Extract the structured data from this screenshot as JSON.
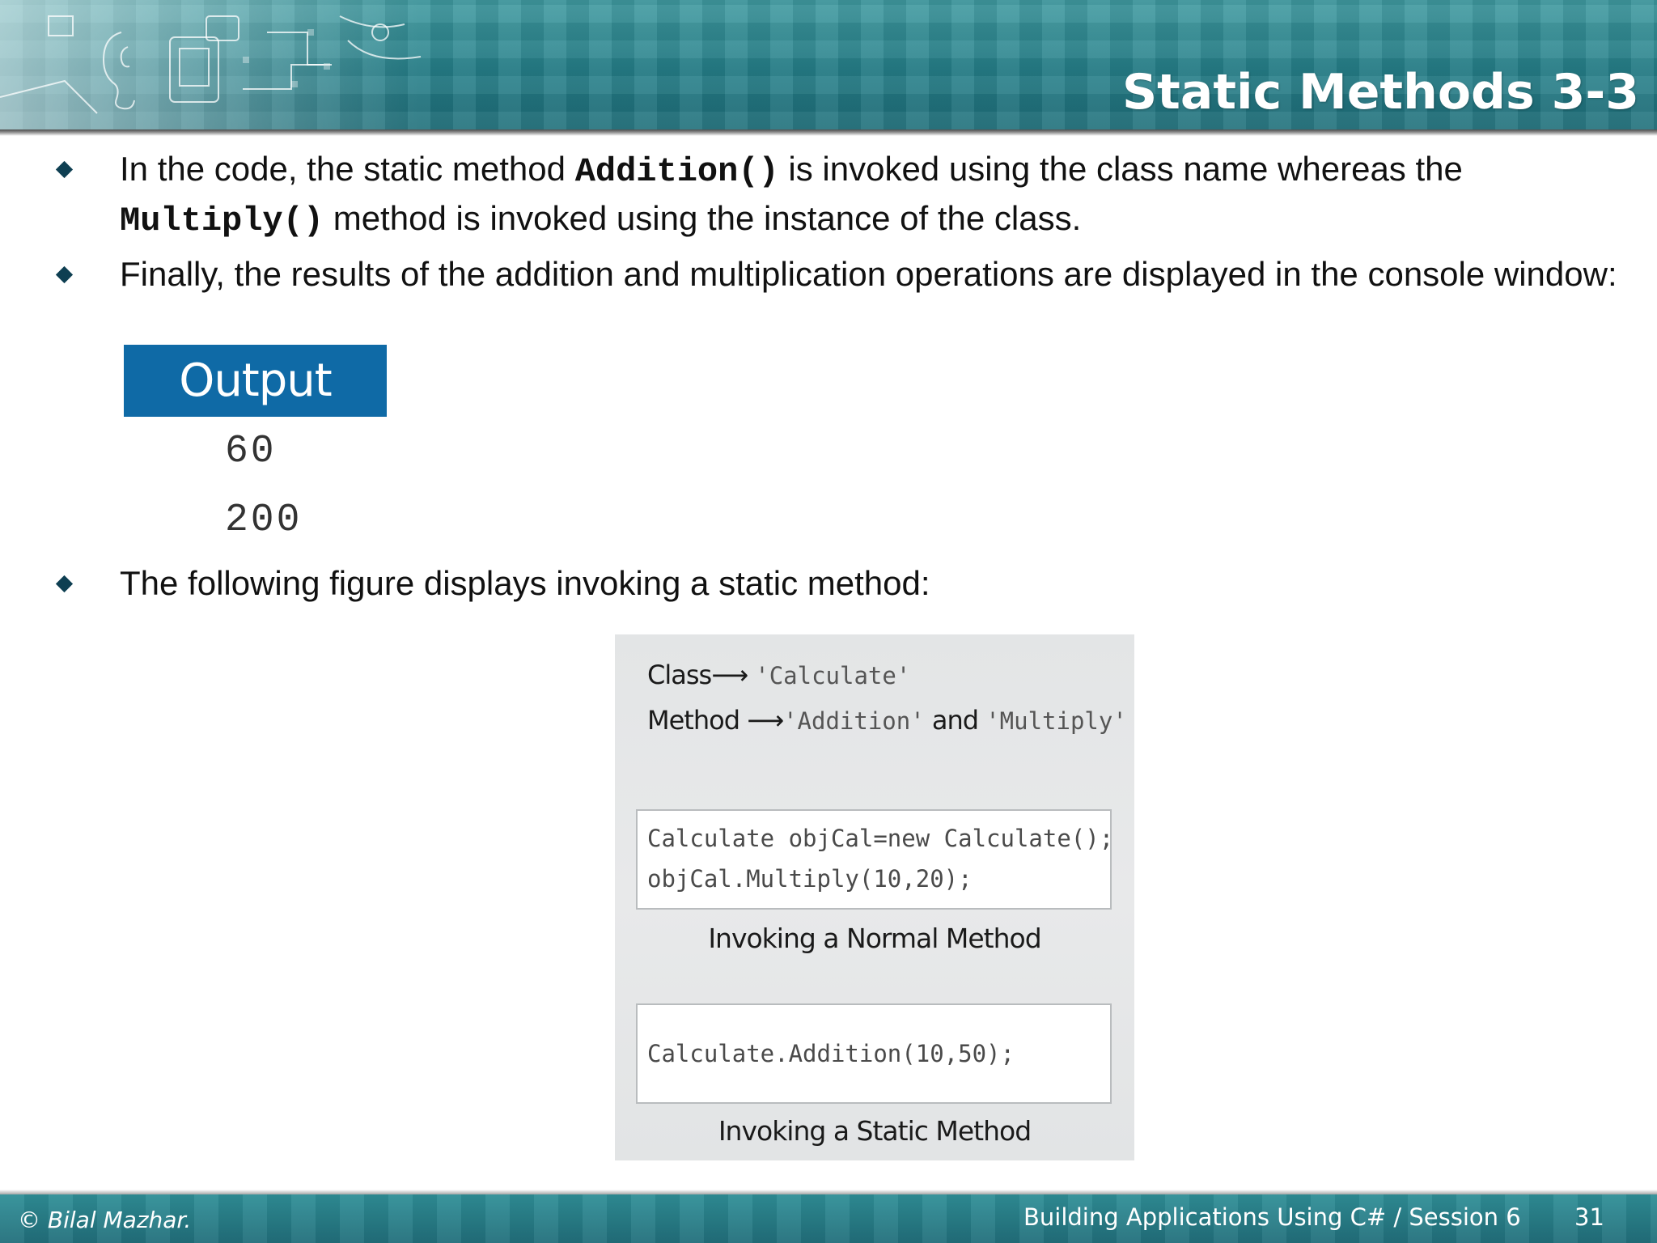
{
  "slide": {
    "title": "Static Methods 3-3"
  },
  "bullets": [
    {
      "text_before": "In the code, the static method ",
      "code_1": "Addition()",
      "text_middle": " is invoked using the class name whereas the ",
      "code_2": "Multiply()",
      "text_after": " method is invoked using the instance of the class."
    },
    {
      "text": "Finally, the results of the addition and multiplication operations are displayed in the console window:"
    },
    {
      "text": "The following figure displays invoking a static method:"
    }
  ],
  "output": {
    "heading": "Output",
    "lines": [
      "60",
      "200"
    ]
  },
  "figure": {
    "class_label": "Class",
    "arrow": "⟶",
    "class_name": "'Calculate'",
    "method_label": "Method",
    "method_1": "'Addition'",
    "method_and": " and ",
    "method_2": "'Multiply'",
    "normal_code": [
      "Calculate objCal=new Calculate();",
      "objCal.Multiply(10,20);"
    ],
    "normal_caption": "Invoking a Normal Method",
    "static_code": [
      "Calculate.Addition(10,50);"
    ],
    "static_caption": "Invoking a Static Method"
  },
  "footer": {
    "copyright": "© Bilal Mazhar.",
    "course": "Building Applications Using C# / Session 6",
    "page_number": "31"
  },
  "colors": {
    "header_teal": "#257f89",
    "output_heading_bg": "#0f6aa6",
    "bullet_marker": "#0e3f52"
  }
}
